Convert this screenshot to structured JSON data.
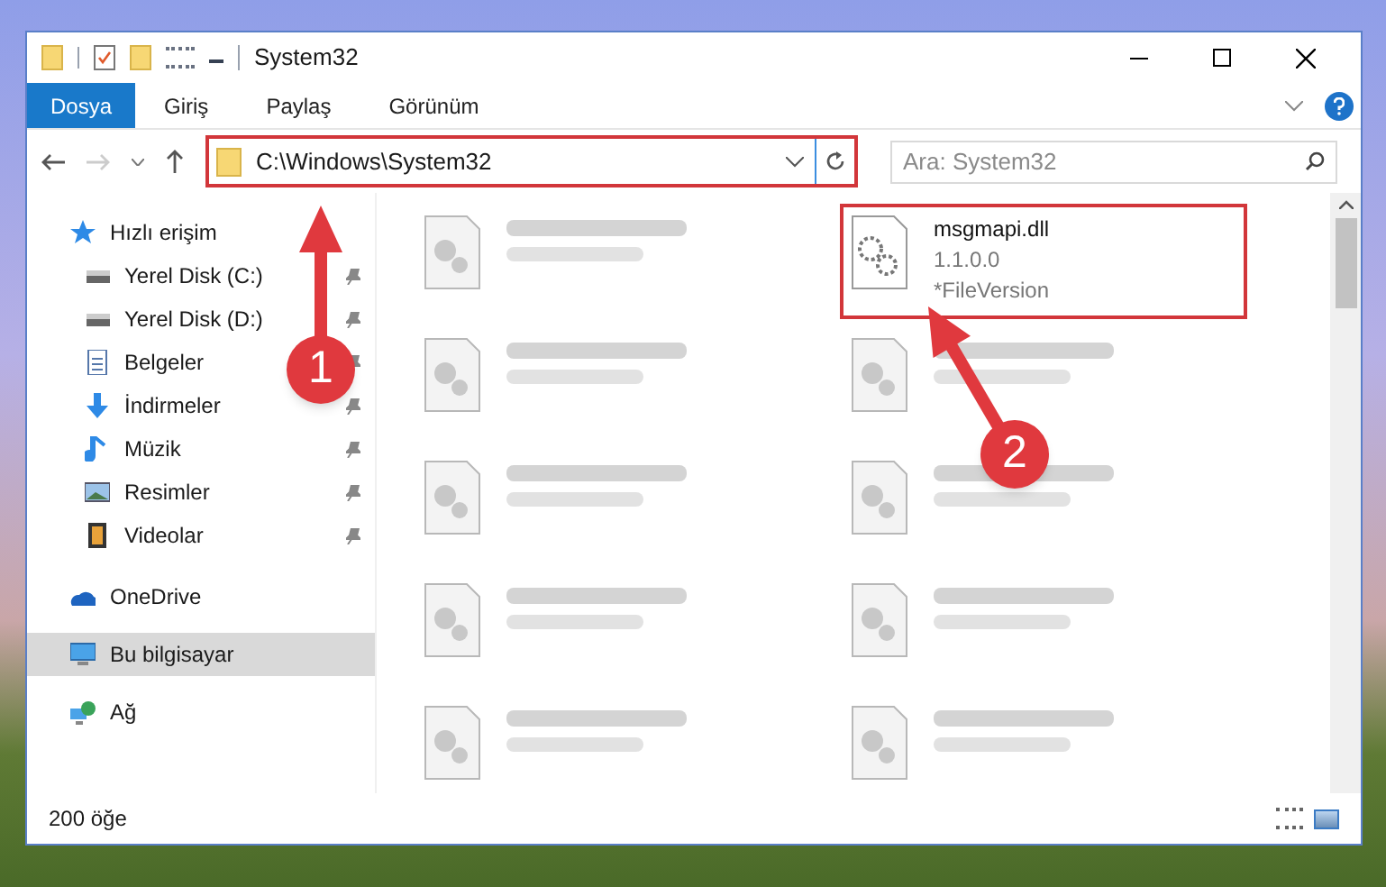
{
  "window": {
    "title": "System32"
  },
  "ribbon_tabs": [
    {
      "label": "Dosya",
      "selected": true
    },
    {
      "label": "Giriş",
      "selected": false
    },
    {
      "label": "Paylaş",
      "selected": false
    },
    {
      "label": "Görünüm",
      "selected": false
    }
  ],
  "address": {
    "path": "C:\\Windows\\System32"
  },
  "search": {
    "placeholder": "Ara: System32"
  },
  "sidebar": {
    "items": [
      {
        "label": "Hızlı erişim",
        "kind": "star",
        "pinned": false,
        "selected": false
      },
      {
        "label": "Yerel Disk (C:)",
        "kind": "disk",
        "pinned": true,
        "selected": false
      },
      {
        "label": "Yerel Disk (D:)",
        "kind": "disk",
        "pinned": true,
        "selected": false
      },
      {
        "label": "Belgeler",
        "kind": "doc",
        "pinned": true,
        "selected": false
      },
      {
        "label": "İndirmeler",
        "kind": "download",
        "pinned": true,
        "selected": false
      },
      {
        "label": "Müzik",
        "kind": "music",
        "pinned": true,
        "selected": false
      },
      {
        "label": "Resimler",
        "kind": "picture",
        "pinned": true,
        "selected": false
      },
      {
        "label": "Videolar",
        "kind": "video",
        "pinned": true,
        "selected": false
      },
      {
        "label": "OneDrive",
        "kind": "cloud",
        "pinned": false,
        "selected": false
      },
      {
        "label": "Bu bilgisayar",
        "kind": "computer",
        "pinned": false,
        "selected": true
      },
      {
        "label": "Ağ",
        "kind": "network",
        "pinned": false,
        "selected": false
      }
    ]
  },
  "files": [
    {
      "blurred": true,
      "highlighted": false
    },
    {
      "name": "msgmapi.dll",
      "detail": "1.1.0.0",
      "detail_2": "*FileVersion",
      "blurred": false,
      "highlighted": true
    },
    {
      "blurred": true,
      "highlighted": false
    },
    {
      "blurred": true,
      "highlighted": false
    },
    {
      "blurred": true,
      "highlighted": false
    },
    {
      "blurred": true,
      "highlighted": false
    },
    {
      "blurred": true,
      "highlighted": false
    },
    {
      "blurred": true,
      "highlighted": false
    },
    {
      "blurred": true,
      "highlighted": false
    },
    {
      "blurred": true,
      "highlighted": false
    }
  ],
  "status_bar": {
    "count": "200 öğe"
  },
  "annotations": [
    {
      "number": "1"
    },
    {
      "number": "2"
    }
  ]
}
